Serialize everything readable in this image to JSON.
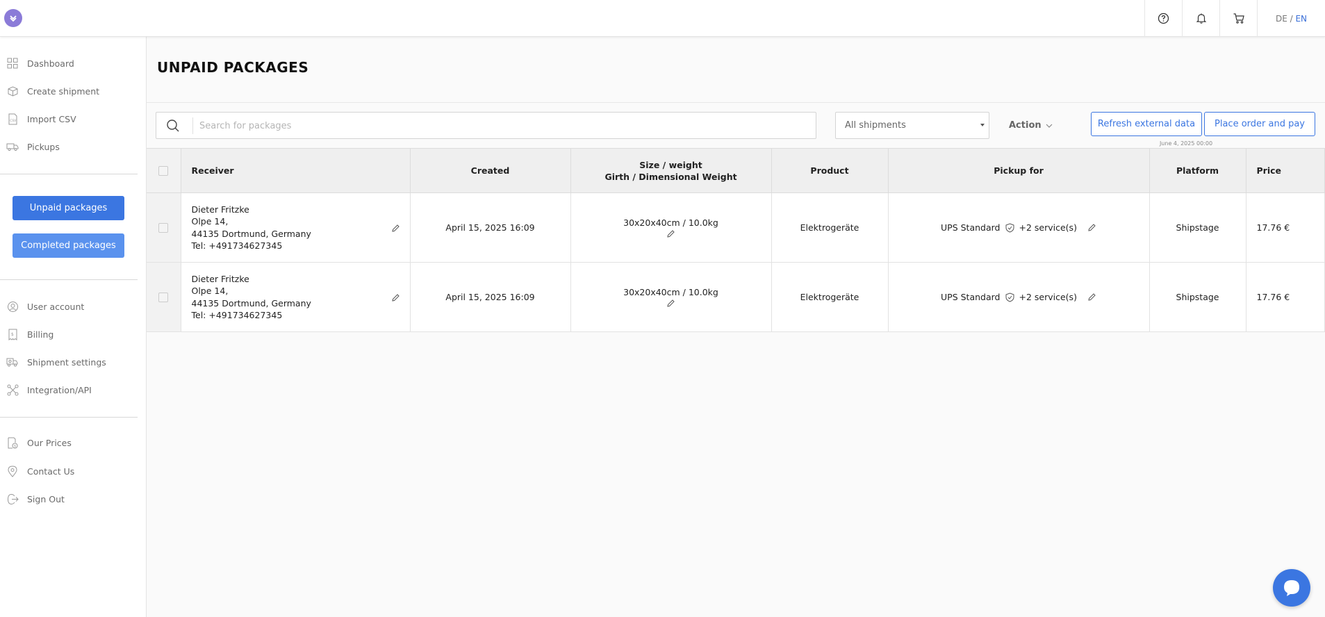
{
  "header": {
    "lang_de": "DE",
    "lang_sep": " / ",
    "lang_en": "EN",
    "icons": [
      "help-icon",
      "bell-icon",
      "cart-icon"
    ]
  },
  "sidebar": {
    "items_top": [
      {
        "label": "Dashboard",
        "icon": "grid-icon"
      },
      {
        "label": "Create shipment",
        "icon": "box-icon"
      },
      {
        "label": "Import CSV",
        "icon": "csv-icon"
      },
      {
        "label": "Pickups",
        "icon": "truck-icon"
      }
    ],
    "unpaid_label": "Unpaid packages",
    "completed_label": "Completed packages",
    "items_mid": [
      {
        "label": "User account",
        "icon": "user-icon"
      },
      {
        "label": "Billing",
        "icon": "billing-icon"
      },
      {
        "label": "Shipment settings",
        "icon": "truck-settings-icon"
      },
      {
        "label": "Integration/API",
        "icon": "network-icon"
      }
    ],
    "items_bottom": [
      {
        "label": "Our Prices",
        "icon": "price-icon"
      },
      {
        "label": "Contact Us",
        "icon": "location-icon"
      },
      {
        "label": "Sign Out",
        "icon": "signout-icon"
      }
    ]
  },
  "main": {
    "title": "UNPAID PACKAGES",
    "search_placeholder": "Search for packages",
    "filter_value": "All shipments",
    "action_label": "Action",
    "refresh_label": "Refresh external data",
    "order_label": "Place order and pay",
    "refresh_date": "June 4, 2025 00:00"
  },
  "table": {
    "headers": {
      "receiver": "Receiver",
      "created": "Created",
      "size_line1": "Size / weight",
      "size_line2": "Girth / Dimensional Weight",
      "product": "Product",
      "pickup": "Pickup for",
      "platform": "Platform",
      "price": "Price"
    },
    "rows": [
      {
        "receiver": [
          "Dieter Fritzke",
          "Olpe 14,",
          "44135 Dortmund, Germany",
          "Tel: +491734627345"
        ],
        "created": "April 15, 2025 16:09",
        "size": "30x20x40cm / 10.0kg",
        "product": "Elektrogeräte",
        "pickup_service": "UPS Standard",
        "pickup_extra": "+2 service(s)",
        "platform": "Shipstage",
        "price": "17.76 €"
      },
      {
        "receiver": [
          "Dieter Fritzke",
          "Olpe 14,",
          "44135 Dortmund, Germany",
          "Tel: +491734627345"
        ],
        "created": "April 15, 2025 16:09",
        "size": "30x20x40cm / 10.0kg",
        "product": "Elektrogeräte",
        "pickup_service": "UPS Standard",
        "pickup_extra": "+2 service(s)",
        "platform": "Shipstage",
        "price": "17.76 €"
      }
    ]
  },
  "colors": {
    "accent": "#3b76e1",
    "accent_light": "#5a92ee",
    "logo": "#8b7bd8"
  }
}
